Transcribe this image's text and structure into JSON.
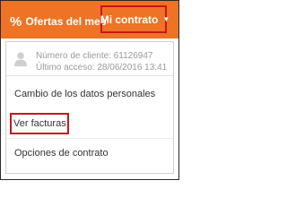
{
  "header": {
    "offers_icon": "percent-icon",
    "offers_label": "Ofertas del mes",
    "contract_label": "Mi contrato",
    "contract_icon": "user-icon",
    "caret_icon": "caret-down-icon",
    "accent_color": "#ee7324",
    "highlight_color": "#c8161d"
  },
  "menu": {
    "client_number": "Número de cliente: 61126947",
    "last_access": "Último acceso: 28/06/2016 13:41",
    "items": [
      {
        "label": "Cambio de los datos personales"
      },
      {
        "label": "Ver facturas"
      },
      {
        "label": "Opciones de contrato"
      }
    ]
  }
}
